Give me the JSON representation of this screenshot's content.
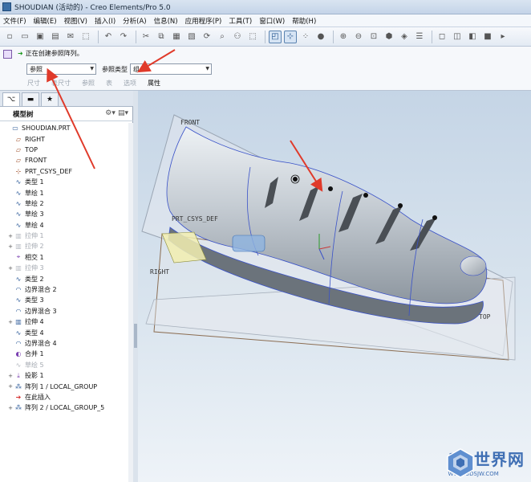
{
  "window": {
    "title": "SHOUDIAN (活动的) - Creo Elements/Pro 5.0"
  },
  "menu": [
    "文件(F)",
    "编辑(E)",
    "视图(V)",
    "插入(I)",
    "分析(A)",
    "信息(N)",
    "应用程序(P)",
    "工具(T)",
    "窗口(W)",
    "帮助(H)"
  ],
  "dashboard": {
    "status": "正在创建参照阵列。",
    "ref_field_value": "参照",
    "ref_type_label": "参照类型",
    "ref_type_value": "组",
    "tabs": [
      "尺寸",
      "表尺寸",
      "参照",
      "表",
      "选项",
      "属性"
    ]
  },
  "model_tree": {
    "header": "模型树",
    "items": [
      {
        "label": "SHOUDIAN.PRT",
        "icon": "part-icon",
        "dim": false,
        "expand": ""
      },
      {
        "label": "RIGHT",
        "icon": "datum-plane-icon",
        "dim": false,
        "expand": ""
      },
      {
        "label": "TOP",
        "icon": "datum-plane-icon",
        "dim": false,
        "expand": ""
      },
      {
        "label": "FRONT",
        "icon": "datum-plane-icon",
        "dim": false,
        "expand": ""
      },
      {
        "label": "PRT_CSYS_DEF",
        "icon": "csys-icon",
        "dim": false,
        "expand": ""
      },
      {
        "label": "类型 1",
        "icon": "sketch-icon",
        "dim": false,
        "expand": ""
      },
      {
        "label": "草绘 1",
        "icon": "sketch-icon",
        "dim": false,
        "expand": ""
      },
      {
        "label": "草绘 2",
        "icon": "sketch-icon",
        "dim": false,
        "expand": ""
      },
      {
        "label": "草绘 3",
        "icon": "sketch-icon",
        "dim": false,
        "expand": ""
      },
      {
        "label": "草绘 4",
        "icon": "sketch-icon",
        "dim": false,
        "expand": ""
      },
      {
        "label": "拉伸 1",
        "icon": "extrude-icon",
        "dim": true,
        "expand": "+"
      },
      {
        "label": "拉伸 2",
        "icon": "extrude-icon",
        "dim": true,
        "expand": "+"
      },
      {
        "label": "相交 1",
        "icon": "intersect-icon",
        "dim": false,
        "expand": ""
      },
      {
        "label": "拉伸 3",
        "icon": "extrude-icon",
        "dim": true,
        "expand": "+"
      },
      {
        "label": "类型 2",
        "icon": "sketch-icon",
        "dim": false,
        "expand": ""
      },
      {
        "label": "边界混合 2",
        "icon": "blend-icon",
        "dim": false,
        "expand": ""
      },
      {
        "label": "类型 3",
        "icon": "sketch-icon",
        "dim": false,
        "expand": ""
      },
      {
        "label": "边界混合 3",
        "icon": "blend-icon",
        "dim": false,
        "expand": ""
      },
      {
        "label": "拉伸 4",
        "icon": "extrude-icon",
        "dim": false,
        "expand": "+"
      },
      {
        "label": "类型 4",
        "icon": "sketch-icon",
        "dim": false,
        "expand": ""
      },
      {
        "label": "边界混合 4",
        "icon": "blend-icon",
        "dim": false,
        "expand": ""
      },
      {
        "label": "合并 1",
        "icon": "merge-icon",
        "dim": false,
        "expand": ""
      },
      {
        "label": "草绘 5",
        "icon": "sketch-icon",
        "dim": true,
        "expand": ""
      },
      {
        "label": "投影 1",
        "icon": "project-icon",
        "dim": false,
        "expand": "+"
      },
      {
        "label": "阵列 1 / LOCAL_GROUP",
        "icon": "pattern-icon",
        "dim": false,
        "expand": "+"
      },
      {
        "label": "在此插入",
        "icon": "insert-arrow-icon",
        "dim": false,
        "expand": ""
      },
      {
        "label": "阵列 2 / LOCAL_GROUP_5",
        "icon": "pattern-icon",
        "dim": false,
        "expand": "+"
      }
    ]
  },
  "viewport": {
    "labels": {
      "front": "FRONT",
      "right": "RIGHT",
      "top": "TOP",
      "csys": "PRT_CSYS_DEF"
    }
  },
  "watermark": {
    "title": "3D世界网",
    "url": "WWW.3DSJW.COM"
  },
  "colors": {
    "annotation_arrow": "#e03a2a",
    "accent": "#3f6fb4"
  }
}
